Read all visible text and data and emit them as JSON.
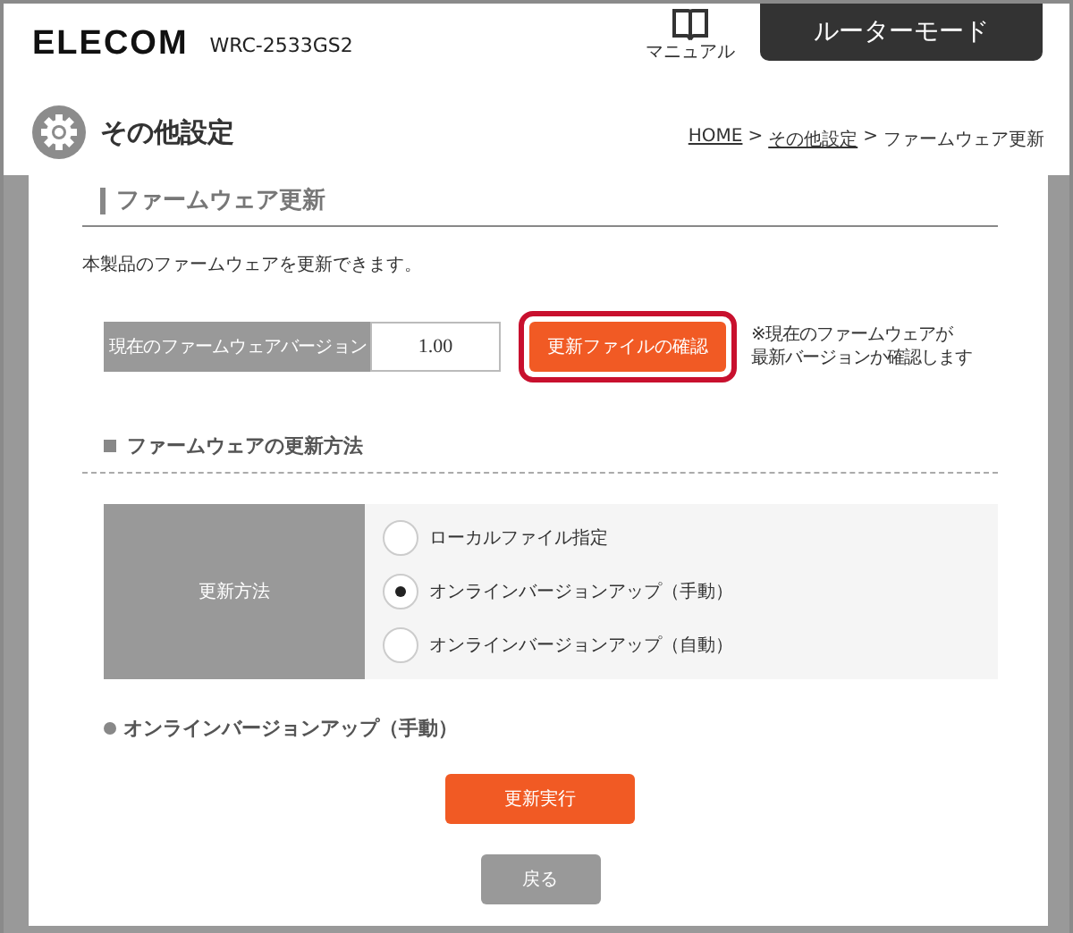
{
  "header": {
    "logo": "ELECOM",
    "model": "WRC-2533GS2",
    "manual_label": "マニュアル",
    "mode": "ルーターモード"
  },
  "page": {
    "title": "その他設定",
    "breadcrumb": [
      {
        "label": "HOME",
        "link": true
      },
      {
        "label": ">",
        "link": false
      },
      {
        "label": "その他設定",
        "link": true
      },
      {
        "label": ">",
        "link": false
      },
      {
        "label": "ファームウェア更新",
        "link": false
      }
    ]
  },
  "section": {
    "title": "ファームウェア更新",
    "description": "本製品のファームウェアを更新できます。",
    "version": {
      "label": "現在のファームウェアバージョン",
      "value": "1.00"
    },
    "check_button": {
      "label": "更新ファイルの確認",
      "highlighted": true
    },
    "note": [
      "※現在のファームウェアが",
      "最新バージョンか確認します"
    ]
  },
  "method": {
    "title": "ファームウェアの更新方法",
    "label": "更新方法",
    "options": [
      {
        "label": "ローカルファイル指定",
        "selected": false
      },
      {
        "label": "オンラインバージョンアップ（手動）",
        "selected": true
      },
      {
        "label": "オンラインバージョンアップ（自動）",
        "selected": false
      }
    ]
  },
  "subsection": {
    "title": "オンラインバージョンアップ（手動）"
  },
  "buttons": [
    {
      "label": "更新実行",
      "kind": "primary"
    },
    {
      "label": "戻る",
      "kind": "secondary"
    }
  ]
}
